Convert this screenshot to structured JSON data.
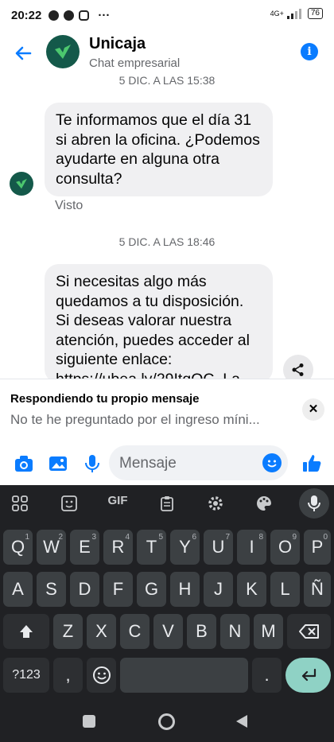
{
  "status_bar": {
    "time": "20:22",
    "dots": "···",
    "network": "4G+",
    "battery": "76"
  },
  "header": {
    "title": "Unicaja",
    "subtitle": "Chat empresarial"
  },
  "messages": [
    {
      "timestamp": "5 DIC. A LAS 15:38",
      "text": "Te informamos que el día 31 si abren la oficina. ¿Podemos ayudarte en alguna otra consulta?",
      "status": "Visto"
    },
    {
      "timestamp": "5 DIC. A LAS 18:46",
      "text": "Si necesitas algo más quedamos a tu disposición. Si deseas valorar nuestra atención, puedes acceder al siguiente enlace: https://ubea.ly/29ItqOC. La"
    }
  ],
  "reply": {
    "title": "Respondiendo tu propio mensaje",
    "quoted": "No te he preguntado por el ingreso míni..."
  },
  "composer": {
    "placeholder": "Mensaje"
  },
  "keyboard": {
    "toolbar": [
      "GIF"
    ],
    "row1": [
      {
        "k": "Q",
        "n": "1"
      },
      {
        "k": "W",
        "n": "2"
      },
      {
        "k": "E",
        "n": "3"
      },
      {
        "k": "R",
        "n": "4"
      },
      {
        "k": "T",
        "n": "5"
      },
      {
        "k": "Y",
        "n": "6"
      },
      {
        "k": "U",
        "n": "7"
      },
      {
        "k": "I",
        "n": "8"
      },
      {
        "k": "O",
        "n": "9"
      },
      {
        "k": "P",
        "n": "0"
      }
    ],
    "row2": [
      "A",
      "S",
      "D",
      "F",
      "G",
      "H",
      "J",
      "K",
      "L",
      "Ñ"
    ],
    "row3": [
      "Z",
      "X",
      "C",
      "V",
      "B",
      "N",
      "M"
    ],
    "row4": {
      "symbols": "?123",
      "comma": ",",
      "period": "."
    }
  },
  "colors": {
    "accent": "#0a7cff",
    "brand": "#14594a",
    "keyboard_bg": "#202124",
    "key_bg": "#3c4043",
    "enter": "#8fd2c5"
  }
}
